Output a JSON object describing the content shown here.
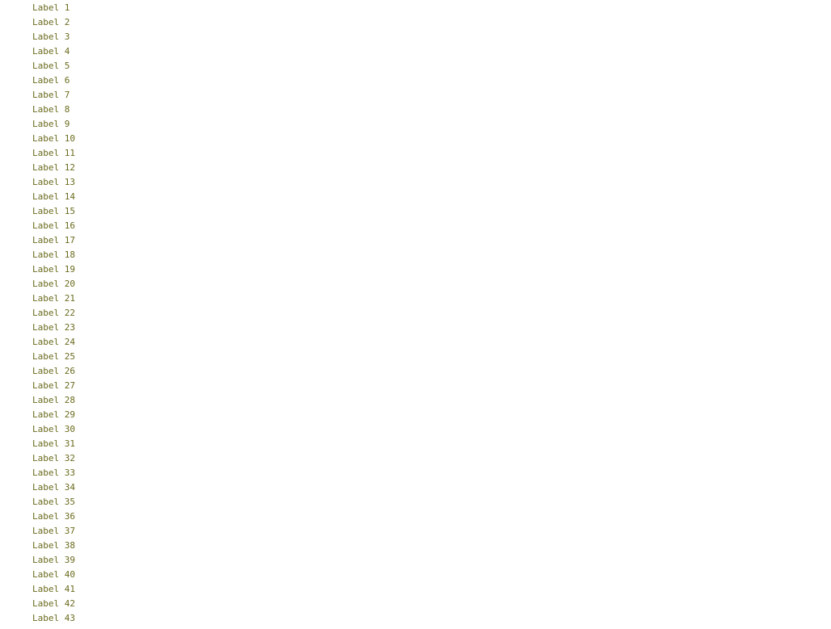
{
  "rows": [
    {
      "label": "Label 1",
      "range_pre": "",
      "range_red": "",
      "range_post": "",
      "value": "",
      "desc": "",
      "desc_range_pre": "",
      "desc_range_red": "",
      "desc_range_post": "",
      "desc_hex": ""
    },
    {
      "label": "Label 2",
      "range_pre": "",
      "range_red": "",
      "range_post": "",
      "value": "",
      "desc": "",
      "desc_range_pre": "",
      "desc_range_red": "",
      "desc_range_post": "",
      "desc_hex": ""
    },
    {
      "label": "Label 3",
      "range_pre": "",
      "range_red": "",
      "range_post": "",
      "value": "",
      "desc": "",
      "desc_range_pre": "",
      "desc_range_red": "",
      "desc_range_post": "",
      "desc_hex": ""
    },
    {
      "label": "Label 4",
      "range_pre": "",
      "range_red": "",
      "range_post": "",
      "value": "",
      "desc": "",
      "desc_range_pre": "",
      "desc_range_red": "",
      "desc_range_post": "",
      "desc_hex": ""
    },
    {
      "label": "Label 5",
      "range_pre": "",
      "range_red": "",
      "range_post": "",
      "value": "",
      "desc": "",
      "desc_range_pre": "",
      "desc_range_red": "",
      "desc_range_post": "",
      "desc_hex": ""
    },
    {
      "label": "Label 6",
      "range_pre": "",
      "range_red": "",
      "range_post": "",
      "value": "",
      "desc": "",
      "desc_range_pre": "",
      "desc_range_red": "",
      "desc_range_post": "",
      "desc_hex": ""
    },
    {
      "label": "Label 7",
      "range_pre": "",
      "range_red": "",
      "range_post": "",
      "value": "",
      "desc": "",
      "desc_range_pre": "",
      "desc_range_red": "",
      "desc_range_post": "",
      "desc_hex": ""
    },
    {
      "label": "Label 8",
      "range_pre": "",
      "range_red": "",
      "range_post": "",
      "value": "",
      "desc": "",
      "desc_range_pre": "",
      "desc_range_red": "",
      "desc_range_post": "",
      "desc_hex": ""
    },
    {
      "label": "Label 9",
      "range_pre": "",
      "range_red": "",
      "range_post": "",
      "value": "",
      "desc": "",
      "desc_range_pre": "",
      "desc_range_red": "",
      "desc_range_post": "",
      "desc_hex": ""
    },
    {
      "label": "Label 10",
      "range_pre": "",
      "range_red": "",
      "range_post": "",
      "value": "",
      "desc": "",
      "desc_range_pre": "",
      "desc_range_red": "",
      "desc_range_post": "",
      "desc_hex": ""
    },
    {
      "label": "Label 11",
      "range_pre": "",
      "range_red": "",
      "range_post": "",
      "value": "",
      "desc": "",
      "desc_range_pre": "",
      "desc_range_red": "",
      "desc_range_post": "",
      "desc_hex": ""
    },
    {
      "label": "Label 12",
      "range_pre": "",
      "range_red": "",
      "range_post": "",
      "value": "",
      "desc": "",
      "desc_range_pre": "",
      "desc_range_red": "",
      "desc_range_post": "",
      "desc_hex": ""
    },
    {
      "label": "Label 13",
      "range_pre": "",
      "range_red": "",
      "range_post": "",
      "value": "",
      "desc": "",
      "desc_range_pre": "",
      "desc_range_red": "",
      "desc_range_post": "",
      "desc_hex": ""
    },
    {
      "label": "Label 14",
      "range_pre": "",
      "range_red": "",
      "range_post": "",
      "value": "",
      "desc": "",
      "desc_range_pre": "",
      "desc_range_red": "",
      "desc_range_post": "",
      "desc_hex": ""
    },
    {
      "label": "Label 15",
      "range_pre": "",
      "range_red": "",
      "range_post": "",
      "value": "",
      "desc": "",
      "desc_range_pre": "",
      "desc_range_red": "",
      "desc_range_post": "",
      "desc_hex": ""
    },
    {
      "label": "Label 16",
      "range_pre": "",
      "range_red": "",
      "range_post": "",
      "value": "",
      "desc": "",
      "desc_range_pre": "",
      "desc_range_red": "",
      "desc_range_post": "",
      "desc_hex": ""
    },
    {
      "label": "Label 17",
      "range_pre": "",
      "range_red": "",
      "range_post": "",
      "value": "",
      "desc": "",
      "desc_range_pre": "",
      "desc_range_red": "",
      "desc_range_post": "",
      "desc_hex": ""
    },
    {
      "label": "Label 18",
      "range_pre": "",
      "range_red": "",
      "range_post": "",
      "value": "",
      "desc": "",
      "desc_range_pre": "",
      "desc_range_red": "",
      "desc_range_post": "",
      "desc_hex": ""
    },
    {
      "label": "Label 19",
      "range_pre": "",
      "range_red": "",
      "range_post": "",
      "value": "",
      "desc": "",
      "desc_range_pre": "",
      "desc_range_red": "",
      "desc_range_post": "",
      "desc_hex": ""
    },
    {
      "label": "Label 20",
      "range_pre": "",
      "range_red": "",
      "range_post": "",
      "value": "",
      "desc": "",
      "desc_range_pre": "",
      "desc_range_red": "",
      "desc_range_post": "",
      "desc_hex": ""
    },
    {
      "label": "Label 21",
      "range_pre": "",
      "range_red": "",
      "range_post": "",
      "value": "",
      "desc": "",
      "desc_range_pre": "",
      "desc_range_red": "",
      "desc_range_post": "",
      "desc_hex": ""
    },
    {
      "label": "Label 22",
      "range_pre": "",
      "range_red": "",
      "range_post": "",
      "value": "",
      "desc": "",
      "desc_range_pre": "",
      "desc_range_red": "",
      "desc_range_post": "",
      "desc_hex": ""
    },
    {
      "label": "Label 23",
      "range_pre": "",
      "range_red": "",
      "range_post": "",
      "value": "",
      "desc": "",
      "desc_range_pre": "",
      "desc_range_red": "",
      "desc_range_post": "",
      "desc_hex": ""
    },
    {
      "label": "Label 24",
      "range_pre": "",
      "range_red": "",
      "range_post": "",
      "value": "",
      "desc": "",
      "desc_range_pre": "",
      "desc_range_red": "",
      "desc_range_post": "",
      "desc_hex": ""
    },
    {
      "label": "Label 25",
      "range_pre": "",
      "range_red": "",
      "range_post": "",
      "value": "",
      "desc": "",
      "desc_range_pre": "",
      "desc_range_red": "",
      "desc_range_post": "",
      "desc_hex": ""
    },
    {
      "label": "Label 26",
      "range_pre": "",
      "range_red": "",
      "range_post": "",
      "value": "",
      "desc": "",
      "desc_range_pre": "",
      "desc_range_red": "",
      "desc_range_post": "",
      "desc_hex": ""
    },
    {
      "label": "Label 27",
      "range_pre": "",
      "range_red": "",
      "range_post": "",
      "value": "",
      "desc": "",
      "desc_range_pre": "",
      "desc_range_red": "",
      "desc_range_post": "",
      "desc_hex": ""
    },
    {
      "label": "Label 28",
      "range_pre": "",
      "range_red": "",
      "range_post": "",
      "value": "",
      "desc": "",
      "desc_range_pre": "",
      "desc_range_red": "",
      "desc_range_post": "",
      "desc_hex": ""
    },
    {
      "label": "Label 29",
      "range_pre": "",
      "range_red": "",
      "range_post": "",
      "value": "",
      "desc": "",
      "desc_range_pre": "",
      "desc_range_red": "",
      "desc_range_post": "",
      "desc_hex": ""
    },
    {
      "label": "Label 30",
      "range_pre": "",
      "range_red": "",
      "range_post": "",
      "value": "",
      "desc": "",
      "desc_range_pre": "",
      "desc_range_red": "",
      "desc_range_post": "",
      "desc_hex": ""
    },
    {
      "label": "Label 31",
      "range_pre": "",
      "range_red": "",
      "range_post": "",
      "value": "",
      "desc": "",
      "desc_range_pre": "",
      "desc_range_red": "",
      "desc_range_post": "",
      "desc_hex": ""
    },
    {
      "label": "Label 32",
      "range_pre": "",
      "range_red": "",
      "range_post": "",
      "value": "",
      "desc": "",
      "desc_range_pre": "",
      "desc_range_red": "",
      "desc_range_post": "",
      "desc_hex": ""
    },
    {
      "label": "Label 33",
      "range_pre": "",
      "range_red": "",
      "range_post": "",
      "value": "",
      "desc": "",
      "desc_range_pre": "",
      "desc_range_red": "",
      "desc_range_post": "",
      "desc_hex": ""
    },
    {
      "label": "Label 34",
      "range_pre": "",
      "range_red": "",
      "range_post": "",
      "value": "",
      "desc": "",
      "desc_range_pre": "",
      "desc_range_red": "",
      "desc_range_post": "",
      "desc_hex": ""
    },
    {
      "label": "Label 35",
      "range_pre": "",
      "range_red": "",
      "range_post": "",
      "value": "",
      "desc": "",
      "desc_range_pre": "",
      "desc_range_red": "",
      "desc_range_post": "",
      "desc_hex": ""
    },
    {
      "label": "Label 36",
      "range_pre": "",
      "range_red": "",
      "range_post": "",
      "value": "",
      "desc": "",
      "desc_range_pre": "",
      "desc_range_red": "",
      "desc_range_post": "",
      "desc_hex": ""
    },
    {
      "label": "Label 37",
      "range_pre": "",
      "range_red": "",
      "range_post": "",
      "value": "",
      "desc": "",
      "desc_range_pre": "",
      "desc_range_red": "",
      "desc_range_post": "",
      "desc_hex": ""
    },
    {
      "label": "Label 38",
      "range_pre": "",
      "range_red": "",
      "range_post": "",
      "value": "",
      "desc": "",
      "desc_range_pre": "",
      "desc_range_red": "",
      "desc_range_post": "",
      "desc_hex": ""
    },
    {
      "label": "Label 39",
      "range_pre": "",
      "range_red": "",
      "range_post": "",
      "value": "",
      "desc": "",
      "desc_range_pre": "",
      "desc_range_red": "",
      "desc_range_post": "",
      "desc_hex": ""
    },
    {
      "label": "Label 40",
      "range_pre": "",
      "range_red": "",
      "range_post": "",
      "value": "",
      "desc": "",
      "desc_range_pre": "",
      "desc_range_red": "",
      "desc_range_post": "",
      "desc_hex": ""
    },
    {
      "label": "Label 41",
      "range_pre": "",
      "range_red": "",
      "range_post": "",
      "value": "",
      "desc": "",
      "desc_range_pre": "",
      "desc_range_red": "",
      "desc_range_post": "",
      "desc_hex": ""
    },
    {
      "label": "Label 42",
      "range_pre": "",
      "range_red": "",
      "range_post": "",
      "value": "",
      "desc": "",
      "desc_range_pre": "",
      "desc_range_red": "",
      "desc_range_post": "",
      "desc_hex": ""
    },
    {
      "label": "Label 43",
      "range_pre": "",
      "range_red": "",
      "range_post": "",
      "value": "",
      "desc": "",
      "desc_range_pre": "",
      "desc_range_red": "",
      "desc_range_post": "",
      "desc_hex": ""
    }
  ],
  "colors": {
    "root_label": "#1a3a8c",
    "field_label": "#6b6b1f",
    "value": "#222222",
    "range": "#7a7a7a",
    "range_highlight": "#e0301e",
    "hex_value": "#2e8b1e",
    "selection": "#c6e0f5",
    "tree_line": "#a8a8a8"
  }
}
